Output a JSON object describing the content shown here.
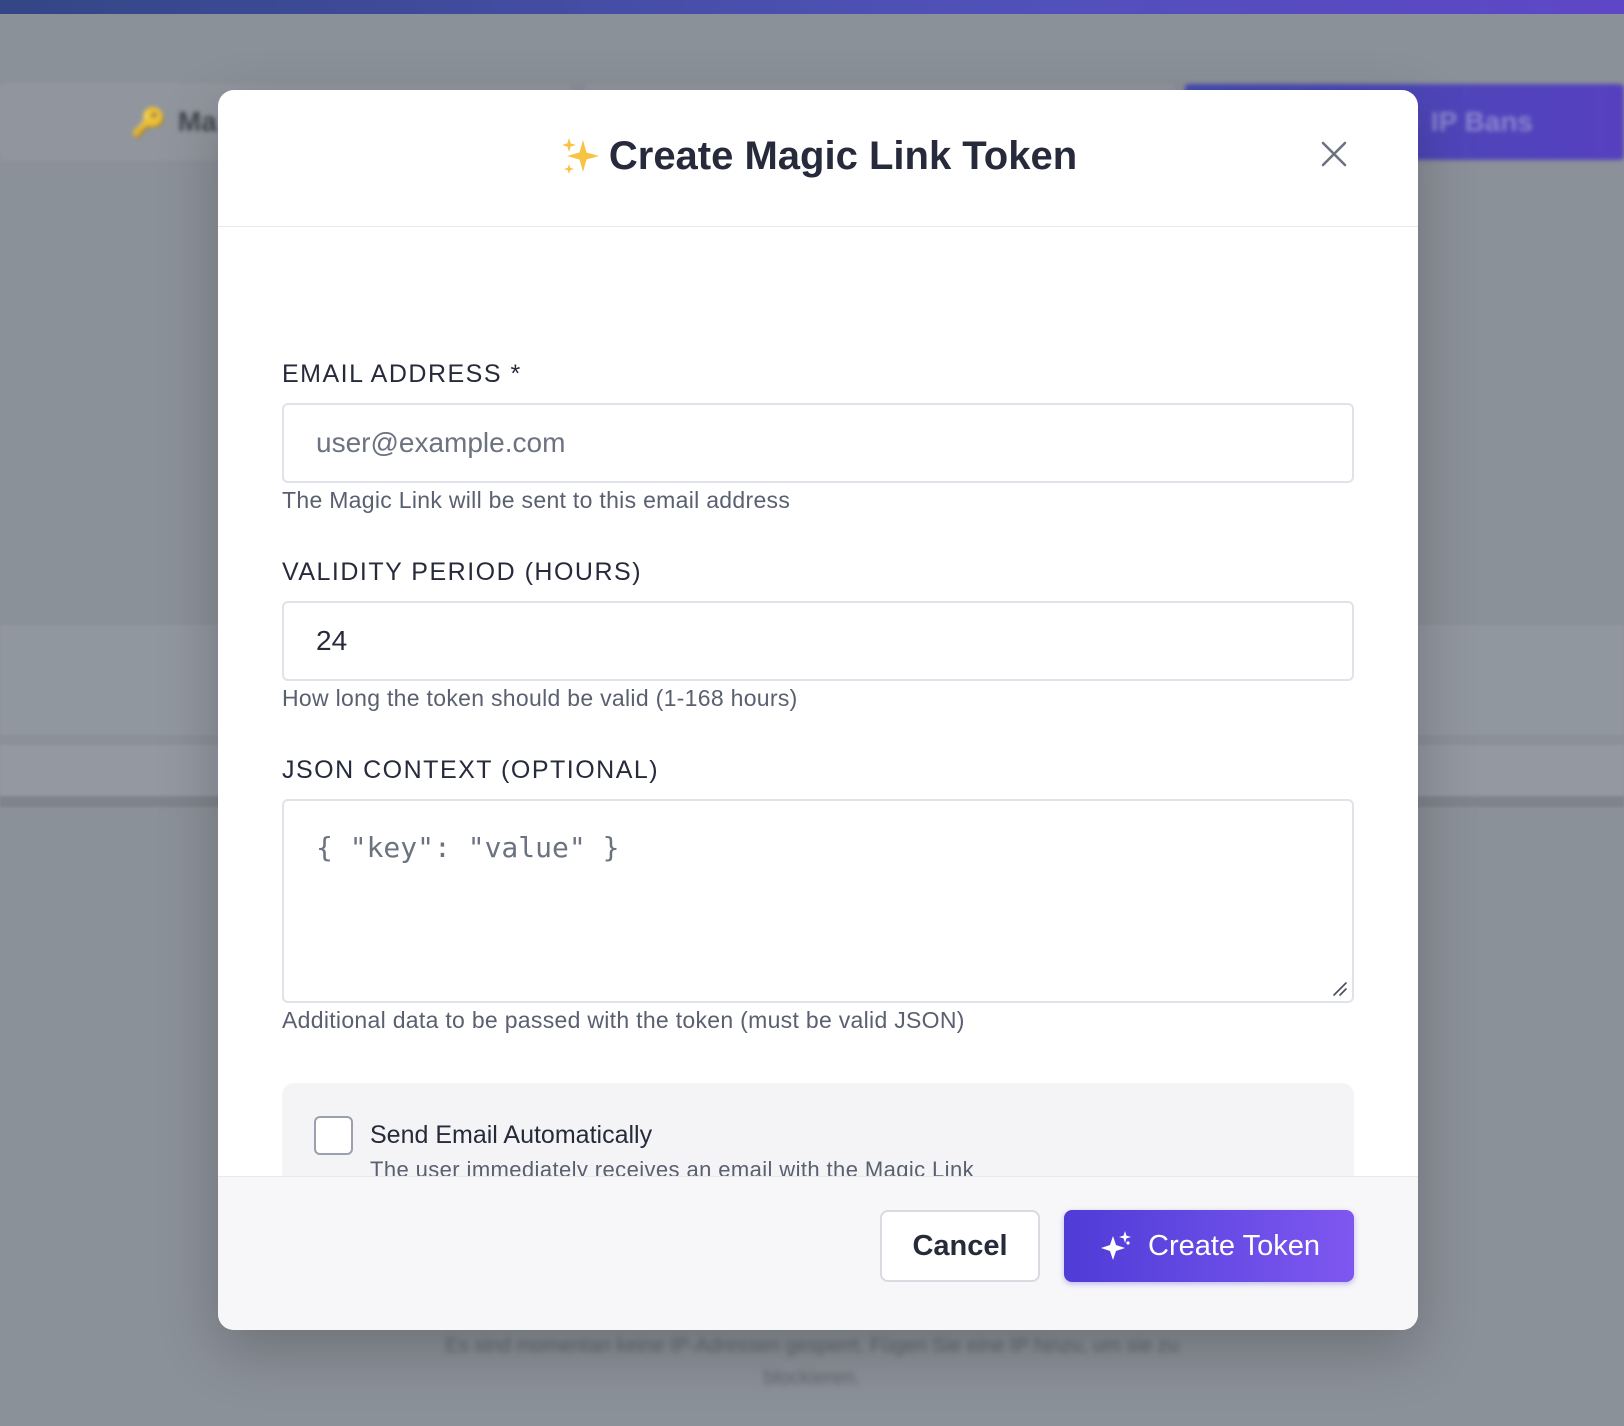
{
  "background": {
    "tab1_label": "Ma",
    "tab3_label": "IP Bans",
    "footnote_line1": "Es sind momentan keine IP-Adressen gesperrt. Fügen Sie eine IP hinzu, um sie zu",
    "footnote_line2": "blockieren."
  },
  "modal": {
    "title_emoji": "✨",
    "title": "Create Magic Link Token",
    "close_icon": "close-icon",
    "email": {
      "label": "EMAIL ADDRESS *",
      "placeholder": "user@example.com",
      "value": "",
      "help": "The Magic Link will be sent to this email address"
    },
    "validity": {
      "label": "VALIDITY PERIOD (HOURS)",
      "value": "24",
      "help": "How long the token should be valid (1-168 hours)"
    },
    "json_context": {
      "label": "JSON CONTEXT (OPTIONAL)",
      "placeholder": "{ \"key\": \"value\" }",
      "help": "Additional data to be passed with the token (must be valid JSON)"
    },
    "send_email": {
      "checked": false,
      "label": "Send Email Automatically",
      "description": "The user immediately receives an email with the Magic Link"
    },
    "footer": {
      "cancel_label": "Cancel",
      "create_label": "Create Token",
      "create_icon": "sparkles-icon"
    }
  },
  "colors": {
    "primary": "#5b43e0",
    "title_text": "#262a3b",
    "help_text": "#5a6070",
    "border": "#dfe2e8",
    "overlay_bg": "#8f959e"
  }
}
